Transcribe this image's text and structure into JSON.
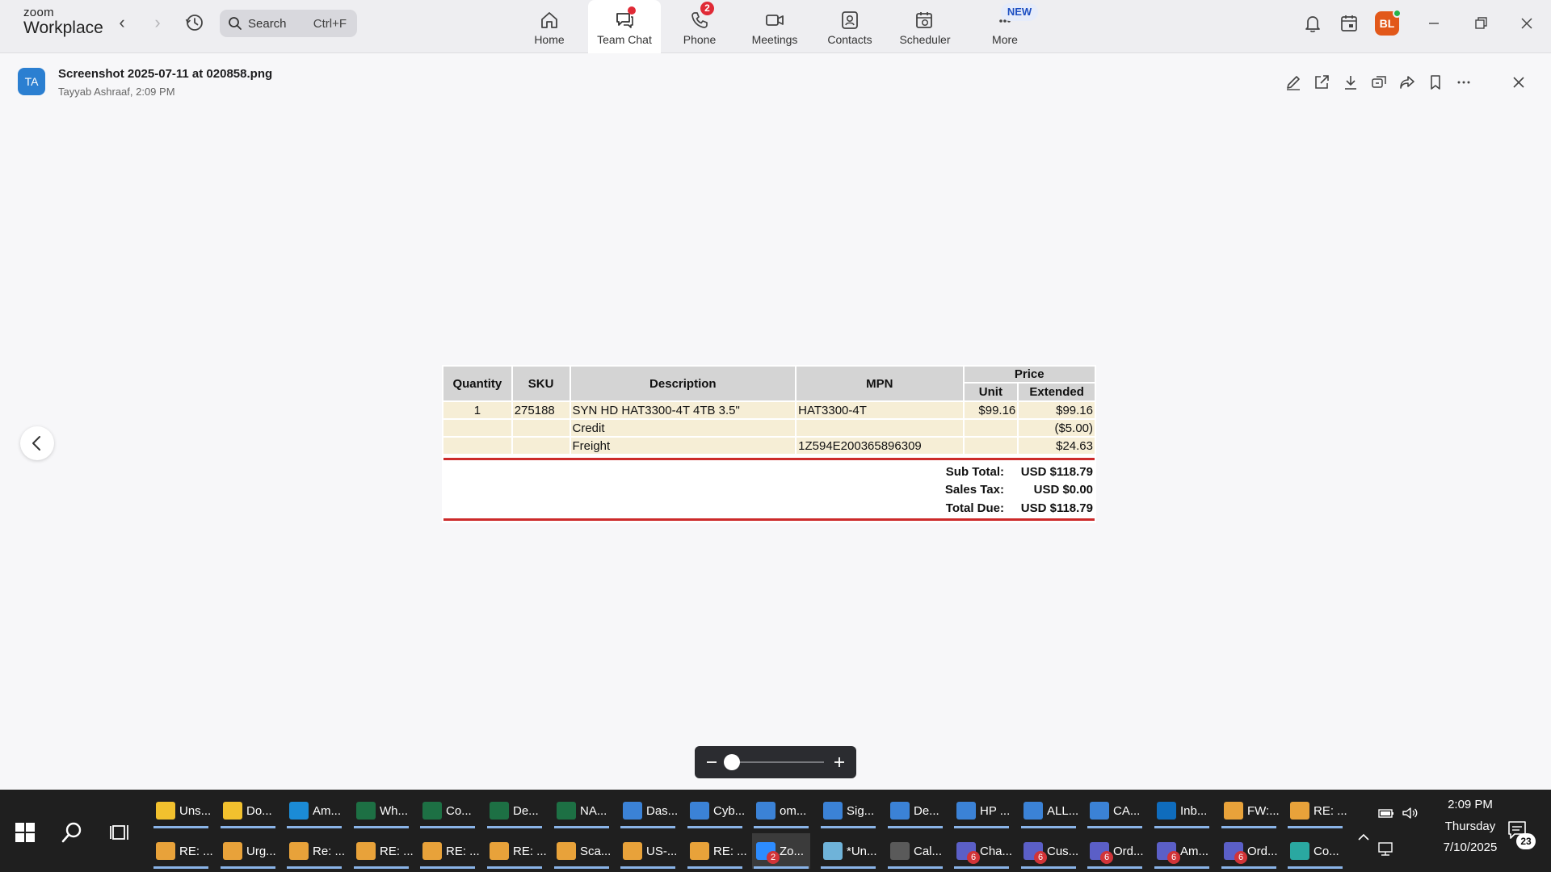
{
  "app": {
    "brand_top": "zoom",
    "brand_bottom": "Workplace",
    "search_placeholder": "Search",
    "search_shortcut": "Ctrl+F",
    "tabs": [
      {
        "label": "Home"
      },
      {
        "label": "Team Chat"
      },
      {
        "label": "Phone",
        "badge": "2"
      },
      {
        "label": "Meetings"
      },
      {
        "label": "Contacts"
      },
      {
        "label": "Scheduler"
      },
      {
        "label": "More",
        "badge": "NEW"
      }
    ],
    "avatar_initials": "BL",
    "active_tab": "Team Chat"
  },
  "file": {
    "avatar_initials": "TA",
    "name": "Screenshot 2025-07-11 at 020858.png",
    "meta": "Tayyab Ashraaf, 2:09 PM"
  },
  "invoice": {
    "headers": {
      "quantity": "Quantity",
      "sku": "SKU",
      "description": "Description",
      "mpn": "MPN",
      "price": "Price",
      "unit": "Unit",
      "extended": "Extended"
    },
    "rows": [
      {
        "quantity": "1",
        "sku": "275188",
        "description": "SYN HD HAT3300-4T 4TB 3.5\"",
        "mpn": "HAT3300-4T",
        "unit": "$99.16",
        "extended": "$99.16"
      },
      {
        "quantity": "",
        "sku": "",
        "description": "Credit",
        "mpn": "",
        "unit": "",
        "extended": "($5.00)"
      },
      {
        "quantity": "",
        "sku": "",
        "description": "Freight",
        "mpn": "1Z594E200365896309",
        "unit": "",
        "extended": "$24.63"
      }
    ],
    "totals": [
      {
        "label": "Sub Total:",
        "value": "USD $118.79"
      },
      {
        "label": "Sales Tax:",
        "value": "USD $0.00"
      },
      {
        "label": "Total Due:",
        "value": "USD $118.79"
      }
    ]
  },
  "taskbar": {
    "row1": [
      {
        "label": "Uns...",
        "icon": "file-explorer-icon",
        "color": "#f2c12e"
      },
      {
        "label": "Do...",
        "icon": "file-explorer-icon",
        "color": "#f2c12e"
      },
      {
        "label": "Am...",
        "icon": "edge-icon",
        "color": "#1b8bd6"
      },
      {
        "label": "Wh...",
        "icon": "excel-icon",
        "color": "#1d7044"
      },
      {
        "label": "Co...",
        "icon": "excel-icon",
        "color": "#1d7044"
      },
      {
        "label": "De...",
        "icon": "excel-icon",
        "color": "#1d7044"
      },
      {
        "label": "NA...",
        "icon": "excel-icon",
        "color": "#1d7044"
      },
      {
        "label": "Das...",
        "icon": "chrome-icon",
        "color": "#3b82d6"
      },
      {
        "label": "Cyb...",
        "icon": "chrome-icon",
        "color": "#3b82d6"
      },
      {
        "label": "om...",
        "icon": "chrome-icon",
        "color": "#3b82d6"
      },
      {
        "label": "Sig...",
        "icon": "chrome-icon",
        "color": "#3b82d6"
      },
      {
        "label": "De...",
        "icon": "chrome-icon",
        "color": "#3b82d6"
      },
      {
        "label": "HP ...",
        "icon": "chrome-icon",
        "color": "#3b82d6"
      },
      {
        "label": "ALL...",
        "icon": "chrome-icon",
        "color": "#3b82d6"
      },
      {
        "label": "CA...",
        "icon": "chrome-icon",
        "color": "#3b82d6"
      },
      {
        "label": "Inb...",
        "icon": "outlook-icon",
        "color": "#0f6cbd"
      },
      {
        "label": "FW:...",
        "icon": "mail-icon",
        "color": "#e8a23a"
      },
      {
        "label": "RE: ...",
        "icon": "mail-icon",
        "color": "#e8a23a"
      }
    ],
    "row2": [
      {
        "label": "RE: ...",
        "icon": "mail-icon",
        "color": "#e8a23a"
      },
      {
        "label": "Urg...",
        "icon": "mail-icon",
        "color": "#e8a23a"
      },
      {
        "label": "Re: ...",
        "icon": "mail-icon",
        "color": "#e8a23a"
      },
      {
        "label": "RE: ...",
        "icon": "mail-icon",
        "color": "#e8a23a"
      },
      {
        "label": "RE: ...",
        "icon": "mail-icon",
        "color": "#e8a23a"
      },
      {
        "label": "RE: ...",
        "icon": "mail-icon",
        "color": "#e8a23a"
      },
      {
        "label": "Sca...",
        "icon": "mail-icon",
        "color": "#e8a23a"
      },
      {
        "label": "US-...",
        "icon": "mail-icon",
        "color": "#e8a23a"
      },
      {
        "label": "RE: ...",
        "icon": "mail-icon",
        "color": "#e8a23a"
      },
      {
        "label": "Zo...",
        "icon": "zoom-icon",
        "color": "#2d8cff",
        "badge": "2",
        "active": true
      },
      {
        "label": "*Un...",
        "icon": "notepad-icon",
        "color": "#6fb3d9"
      },
      {
        "label": "Cal...",
        "icon": "calculator-icon",
        "color": "#5a5a5a"
      },
      {
        "label": "Cha...",
        "icon": "teams-icon",
        "color": "#5b5fc7",
        "badge": "6"
      },
      {
        "label": "Cus...",
        "icon": "teams-icon",
        "color": "#5b5fc7",
        "badge": "6"
      },
      {
        "label": "Ord...",
        "icon": "teams-icon",
        "color": "#5b5fc7",
        "badge": "6"
      },
      {
        "label": "Am...",
        "icon": "teams-icon",
        "color": "#5b5fc7",
        "badge": "6"
      },
      {
        "label": "Ord...",
        "icon": "teams-icon",
        "color": "#5b5fc7",
        "badge": "6"
      },
      {
        "label": "Co...",
        "icon": "copilot-icon",
        "color": "#2aa8a1"
      }
    ],
    "time": "2:09 PM",
    "day": "Thursday",
    "date": "7/10/2025",
    "notifications": "23"
  }
}
